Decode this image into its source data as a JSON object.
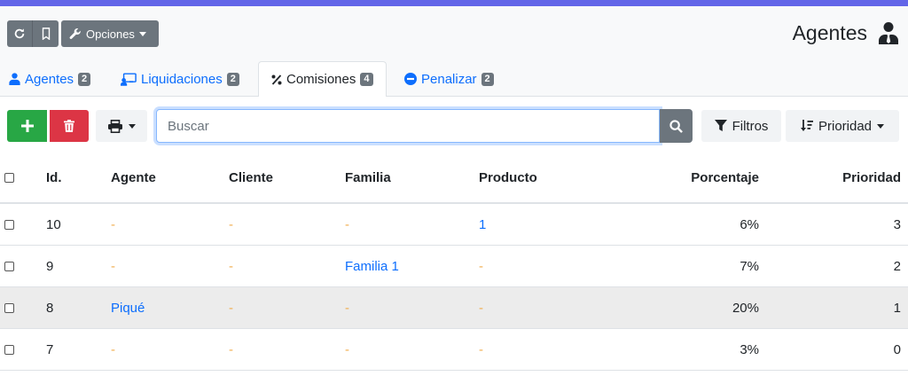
{
  "header": {
    "refresh_icon": "refresh-icon",
    "bookmark_icon": "bookmark-icon",
    "options_label": "Opciones",
    "title": "Agentes",
    "title_icon": "user-tie-icon"
  },
  "tabs": [
    {
      "label": "Agentes",
      "badge": "2",
      "icon": "user-icon"
    },
    {
      "label": "Liquidaciones",
      "badge": "2",
      "icon": "chalkboard-user-icon"
    },
    {
      "label": "Comisiones",
      "badge": "4",
      "icon": "percent-icon"
    },
    {
      "label": "Penalizar",
      "badge": "2",
      "icon": "minus-circle-icon"
    }
  ],
  "toolbar": {
    "search_placeholder": "Buscar",
    "filters_label": "Filtros",
    "priority_label": "Prioridad"
  },
  "table": {
    "columns": [
      "Id.",
      "Agente",
      "Cliente",
      "Familia",
      "Producto",
      "Porcentaje",
      "Prioridad"
    ],
    "rows": [
      {
        "id": "10",
        "agente": "-",
        "cliente": "-",
        "familia": "-",
        "producto": "1",
        "porcentaje": "6%",
        "prioridad": "3"
      },
      {
        "id": "9",
        "agente": "-",
        "cliente": "-",
        "familia": "Familia 1",
        "producto": "-",
        "porcentaje": "7%",
        "prioridad": "2"
      },
      {
        "id": "8",
        "agente": "Piqué",
        "cliente": "-",
        "familia": "-",
        "producto": "-",
        "porcentaje": "20%",
        "prioridad": "1"
      },
      {
        "id": "7",
        "agente": "-",
        "cliente": "-",
        "familia": "-",
        "producto": "-",
        "porcentaje": "3%",
        "prioridad": "0"
      }
    ]
  },
  "colors": {
    "accent_bar": "#6366e8",
    "primary": "#0d6efd",
    "success": "#28a745",
    "danger": "#dc3545",
    "secondary": "#6c757d",
    "dash": "#f0ad4e"
  }
}
